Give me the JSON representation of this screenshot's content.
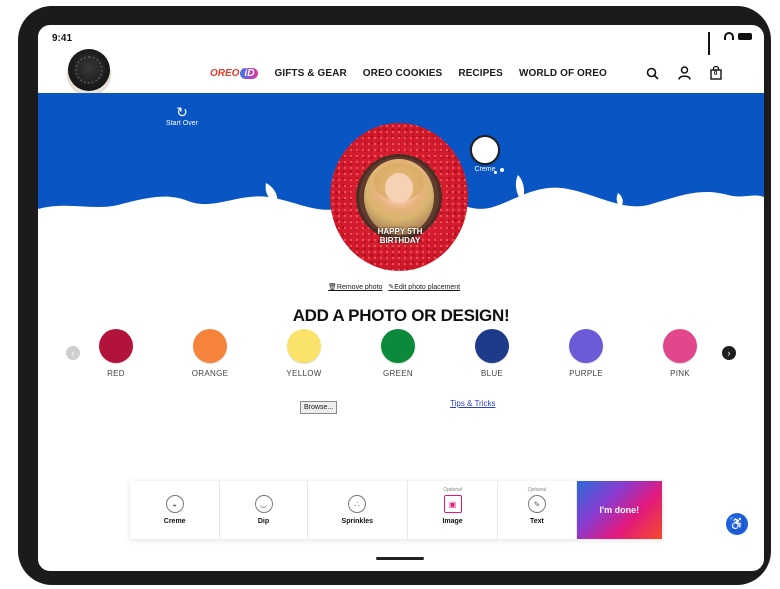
{
  "status": {
    "time": "9:41"
  },
  "nav": {
    "brand_left": "OREO",
    "brand_right": "iD",
    "items": [
      {
        "label": "GIFTS & GEAR"
      },
      {
        "label": "OREO COOKIES"
      },
      {
        "label": "RECIPES"
      },
      {
        "label": "WORLD OF OREO"
      }
    ]
  },
  "header_icons": [
    "search-icon",
    "account-icon",
    "bag-icon"
  ],
  "bag_count": "0",
  "start_over": {
    "label": "Start Over"
  },
  "preview": {
    "cake_text_line1": "HAPPY 5TH",
    "cake_text_line2": "BIRTHDAY"
  },
  "creme_selector": {
    "label": "Creme"
  },
  "photo_actions": {
    "remove": "Remove photo",
    "edit": "Edit photo placement"
  },
  "headline": "ADD A PHOTO OR DESIGN!",
  "colors": [
    {
      "name": "RED",
      "hex": "#b3123b"
    },
    {
      "name": "ORANGE",
      "hex": "#f5833b"
    },
    {
      "name": "YELLOW",
      "hex": "#fbe36b"
    },
    {
      "name": "GREEN",
      "hex": "#0a8a3a"
    },
    {
      "name": "BLUE",
      "hex": "#1e3a8a"
    },
    {
      "name": "PURPLE",
      "hex": "#6b5bd6"
    },
    {
      "name": "PINK",
      "hex": "#e2468b"
    }
  ],
  "browse_label": "Browse...",
  "tips_label": "Tips & Tricks",
  "toolbar": {
    "creme": "Creme",
    "dip": "Dip",
    "sprinkles": "Sprinkles",
    "image": "Image",
    "text": "Text",
    "optional": "Optional",
    "done": "I'm done!"
  },
  "accent": {
    "hero_blue": "#0a55c4"
  }
}
